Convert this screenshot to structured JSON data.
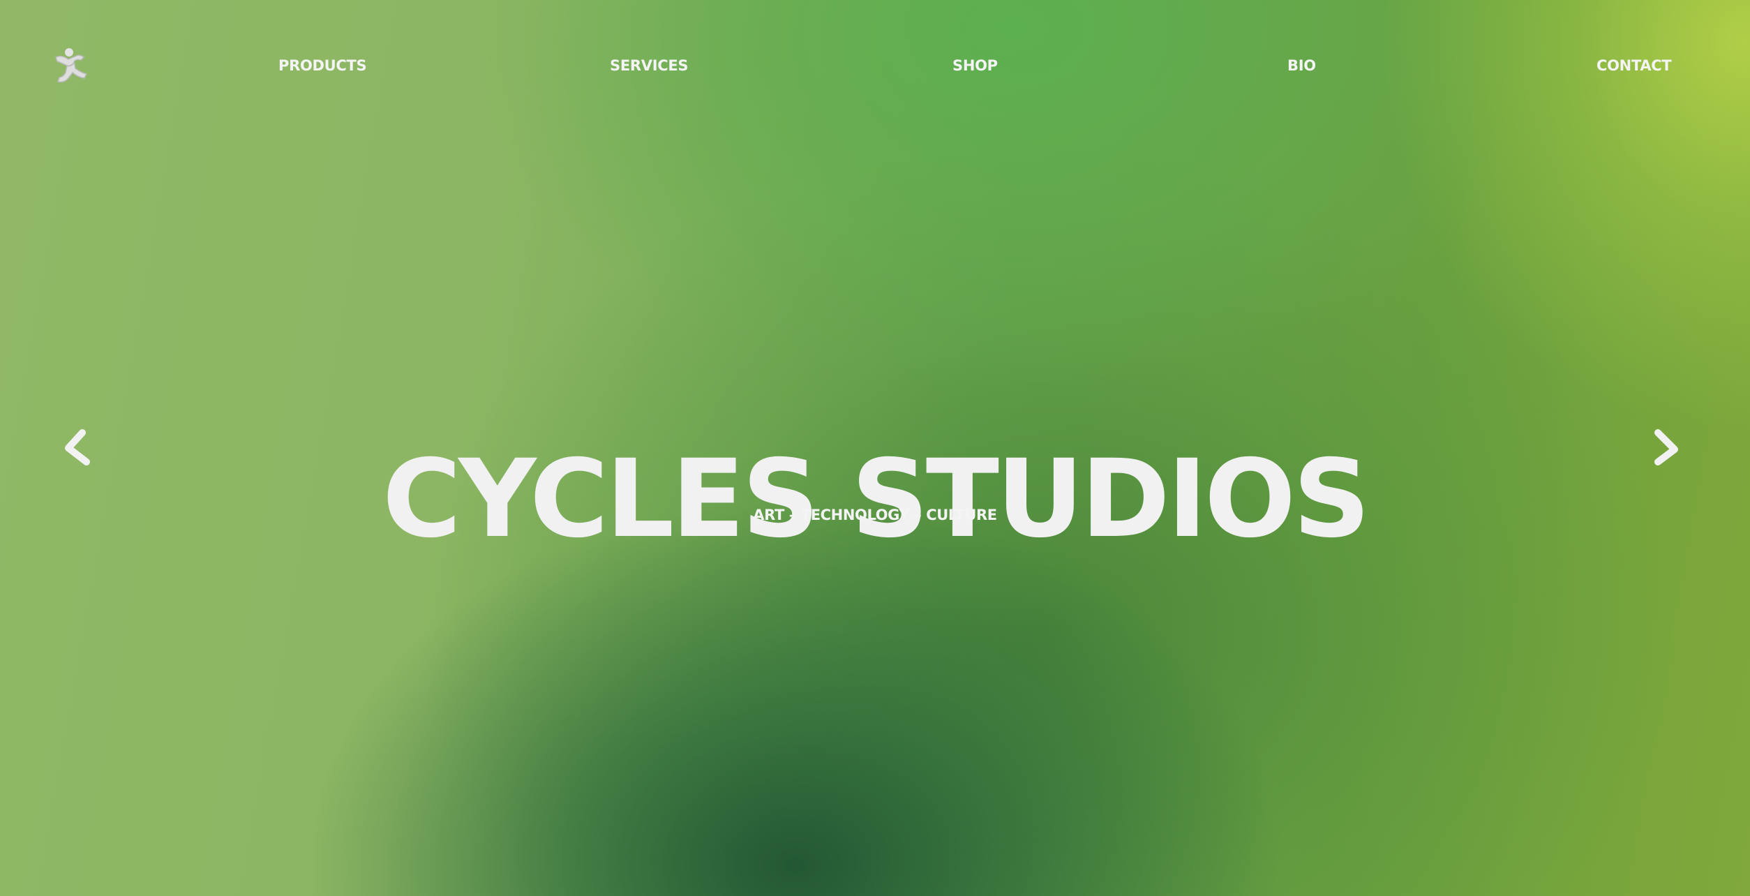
{
  "nav": {
    "logo_icon": "running-figure-logo-icon",
    "items": [
      {
        "label": "PRODUCTS"
      },
      {
        "label": "SERVICES"
      },
      {
        "label": "SHOP"
      },
      {
        "label": "BIO"
      },
      {
        "label": "CONTACT"
      }
    ]
  },
  "hero": {
    "title": "CYCLES STUDIOS",
    "subtitle": "ART – TECHNOLOGY – CULTURE"
  },
  "carousel": {
    "prev_icon": "chevron-left-icon",
    "next_icon": "chevron-right-icon"
  },
  "colors": {
    "text": "#f2f2f2",
    "green_dark": "#2a603a",
    "green_mid": "#65ad50",
    "lime": "#b0cf48",
    "sage": "#90b866"
  }
}
